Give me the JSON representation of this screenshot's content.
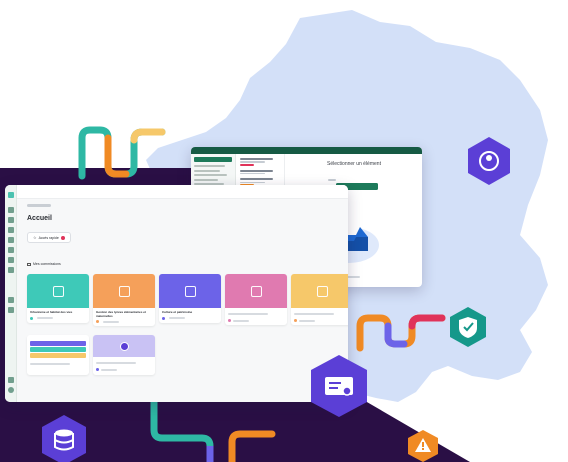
{
  "app_window": {
    "page_title": "Accueil",
    "quick_access_label": "Accès rapide",
    "section_label": "Mes commissions",
    "cards": [
      {
        "title": "Urbanisme et habitat des vies",
        "meta": "",
        "color": "#3ec9b8",
        "dot": "#3ec9b8"
      },
      {
        "title": "Gestion des lycées élémentaires et maternelles",
        "meta": "",
        "color": "#f5a05a",
        "dot": "#f5a05a"
      },
      {
        "title": "Culture et patrimoine",
        "meta": "",
        "color": "#6c63e8",
        "dot": "#6c63e8"
      },
      {
        "title": "",
        "meta": "",
        "color": "#e07ab0",
        "dot": "#e07ab0"
      },
      {
        "title": "",
        "meta": "",
        "color": "#f6c86a",
        "dot": "#f6c86a"
      }
    ]
  },
  "document_window": {
    "header_label": "",
    "panel_title": "Sélectionner un élément",
    "action_button_label": ""
  },
  "colors": {
    "map_fill": "#d3e0f8",
    "dark_band": "#2a0f45",
    "accent_green": "#1d7a5a",
    "hex_purple": "#5b3fd6",
    "hex_orange": "#f08a24",
    "hex_teal": "#15988a"
  },
  "icons": [
    "user-badge-icon",
    "shield-check-icon",
    "certificate-icon",
    "database-icon",
    "warning-icon",
    "inbox-tray-icon"
  ]
}
